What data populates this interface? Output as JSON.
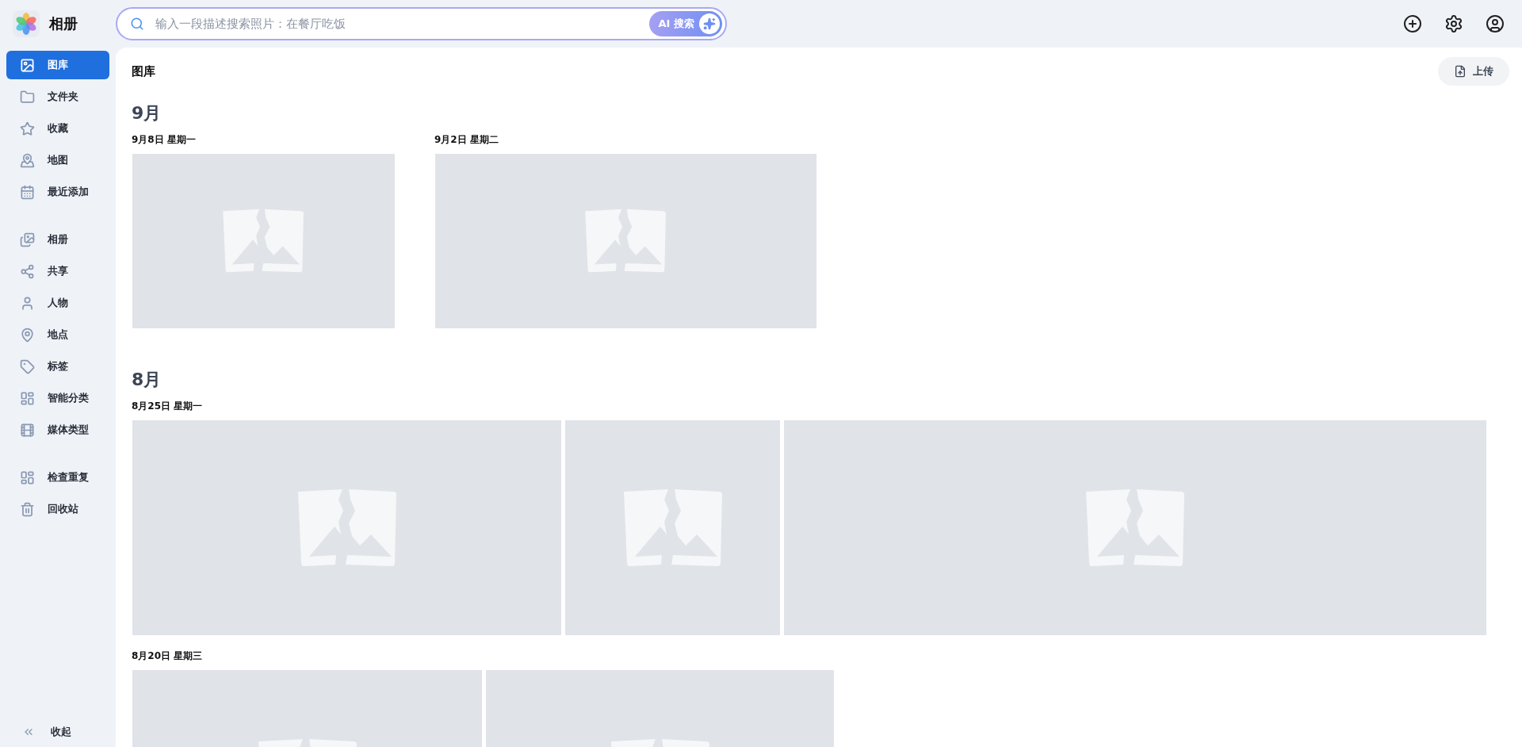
{
  "app": {
    "title": "相册"
  },
  "search": {
    "placeholder": "输入一段描述搜索照片：在餐厅吃饭",
    "ai_button": "AI 搜索"
  },
  "sidebar": {
    "sections": [
      [
        {
          "label": "图库",
          "selected": true
        },
        {
          "label": "文件夹",
          "selected": false
        },
        {
          "label": "收藏",
          "selected": false
        },
        {
          "label": "地图",
          "selected": false
        },
        {
          "label": "最近添加",
          "selected": false
        }
      ],
      [
        {
          "label": "相册",
          "selected": false
        },
        {
          "label": "共享",
          "selected": false
        },
        {
          "label": "人物",
          "selected": false
        },
        {
          "label": "地点",
          "selected": false
        },
        {
          "label": "标签",
          "selected": false
        },
        {
          "label": "智能分类",
          "selected": false
        },
        {
          "label": "媒体类型",
          "selected": false
        }
      ],
      [
        {
          "label": "检查重复",
          "selected": false
        },
        {
          "label": "回收站",
          "selected": false
        }
      ]
    ],
    "collapse": "收起"
  },
  "main": {
    "title": "图库",
    "upload_button": "上传",
    "months": [
      {
        "label": "9月",
        "days": [
          {
            "date": "9月8日 星期一",
            "photos": [
              {
                "kind": "broken"
              }
            ]
          },
          {
            "date": "9月2日 星期二",
            "photos": [
              {
                "kind": "broken"
              }
            ]
          }
        ]
      },
      {
        "label": "8月",
        "days": [
          {
            "date": "8月25日 星期一",
            "photos": [
              {
                "kind": "broken"
              },
              {
                "kind": "broken"
              },
              {
                "kind": "broken"
              }
            ]
          },
          {
            "date": "8月20日 星期三",
            "photos": [
              {
                "kind": "broken"
              },
              {
                "kind": "broken"
              }
            ]
          }
        ]
      }
    ]
  }
}
